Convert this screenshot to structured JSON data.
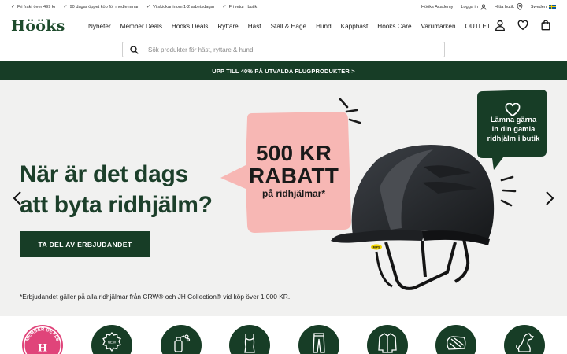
{
  "topbar": {
    "usps": [
      "Fri frakt över 499 kr",
      "90 dagar öppet köp för medlemmar",
      "Vi skickar inom 1-2 arbetsdagar",
      "Fri retur i butik"
    ],
    "academy": "Hööks Academy",
    "login": "Logga in",
    "find_store": "Hitta butik",
    "country": "Sweden"
  },
  "header": {
    "logo": "Hööks",
    "nav": [
      "Nyheter",
      "Member Deals",
      "Hööks Deals",
      "Ryttare",
      "Häst",
      "Stall & Hage",
      "Hund",
      "Käpphäst",
      "Hööks Care",
      "Varumärken",
      "OUTLET"
    ]
  },
  "search": {
    "placeholder": "Sök produkter för häst, ryttare & hund."
  },
  "promo": {
    "text": "UPP TILL 40% PÅ UTVALDA FLUGPRODUKTER >"
  },
  "hero": {
    "heading_line1": "När är det dags",
    "heading_line2": "att byta ridhjälm?",
    "cta": "TA DEL AV ERBJUDANDET",
    "disclaimer": "*Erbjudandet gäller på alla ridhjälmar från CRW® och JH Collection® vid köp över 1 000 KR.",
    "badge_line1": "500 KR",
    "badge_line2": "RABATT",
    "badge_line3": "på ridhjälmar*",
    "green_line1": "Lämna gärna",
    "green_line2": "in din gamla",
    "green_line3": "ridhjälm i butik",
    "helmet_logo": "MIPS",
    "colors": {
      "dark_green": "#173d26",
      "pink": "#f7b7b4",
      "hero_bg": "#f1f1f0"
    }
  },
  "categories": {
    "icons": [
      "member-deals-icon",
      "new-icon",
      "care-products-icon",
      "rider-top-icon",
      "breeches-icon",
      "jacket-icon",
      "horse-rug-icon",
      "dog-icon"
    ],
    "member_label": "MEMBER DEALS",
    "member_letter": "H",
    "new_label": "NEW"
  }
}
